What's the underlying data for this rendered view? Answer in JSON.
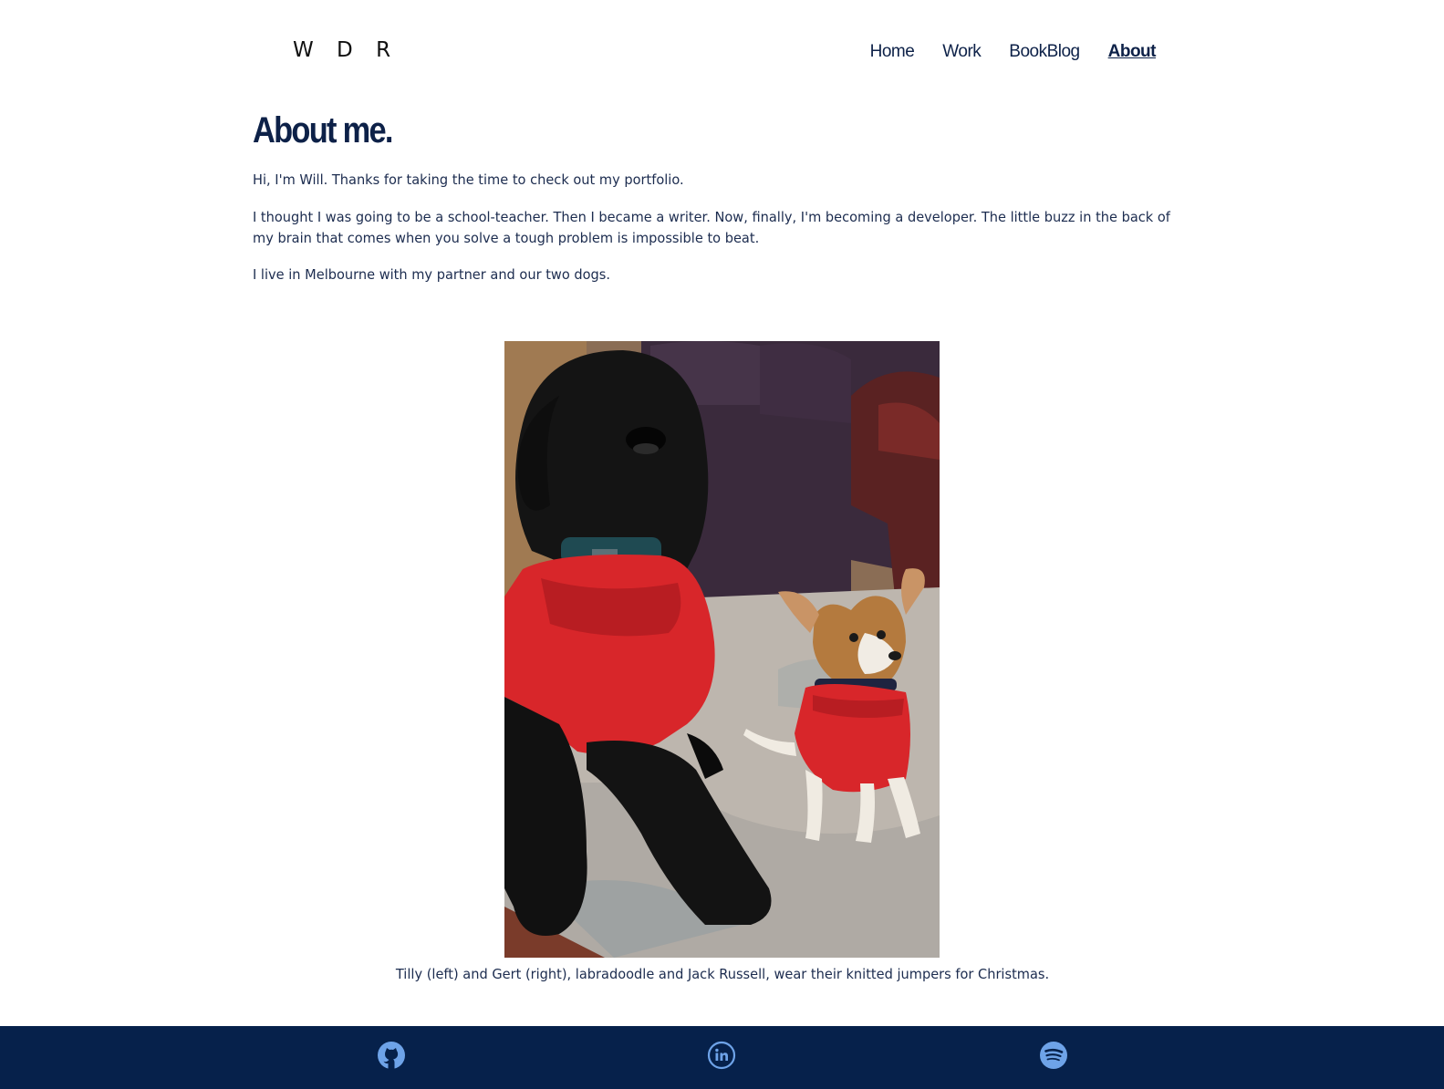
{
  "header": {
    "logo": "W D R",
    "nav": [
      {
        "label": "Home"
      },
      {
        "label": "Work"
      },
      {
        "label": "BookBlog"
      },
      {
        "label": "About",
        "active": true
      }
    ]
  },
  "main": {
    "title": "About me.",
    "paragraphs": [
      "Hi, I'm Will. Thanks for taking the time to check out my portfolio.",
      "I thought I was going to be a school-teacher. Then I became a writer. Now, finally, I'm becoming a developer. The little buzz in the back of my brain that comes when you solve a tough problem is impossible to beat.",
      "I live in Melbourne with my partner and our two dogs."
    ],
    "photo_caption": "Tilly (left) and Gert (right), labradoodle and Jack Russell, wear their knitted jumpers for Christmas."
  },
  "footer": {
    "icons": [
      "github-icon",
      "linkedin-icon",
      "spotify-icon"
    ],
    "background": "#06214b",
    "icon_color": "#6ea3e8"
  },
  "colors": {
    "text": "#0d2148",
    "sweater_red": "#d8262a"
  }
}
